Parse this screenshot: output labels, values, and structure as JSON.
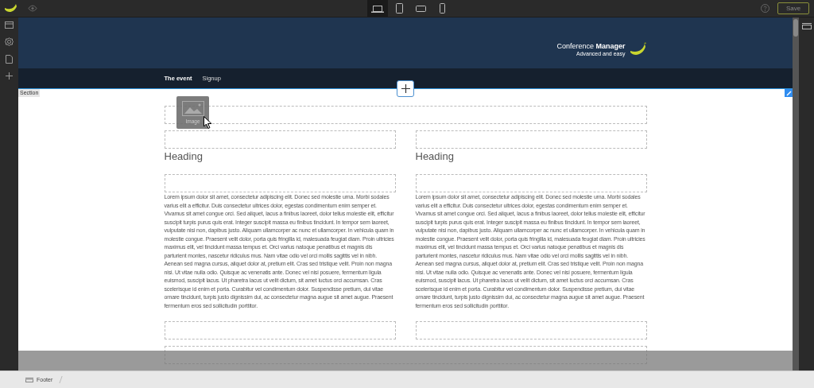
{
  "toolbar": {
    "devices": [
      {
        "kind": "laptop",
        "selected": true
      },
      {
        "kind": "tablet",
        "selected": false
      },
      {
        "kind": "tablet-landscape",
        "selected": false
      },
      {
        "kind": "phone",
        "selected": false
      }
    ],
    "save_button": "Save"
  },
  "site_header": {
    "brand_light": "Conference",
    "brand_bold": "Manager",
    "tagline": "Advanced and easy"
  },
  "nav": [
    {
      "label": "The event",
      "selected": true
    },
    {
      "label": "Signup",
      "selected": false
    }
  ],
  "section_label": "Section",
  "drag_item": {
    "label": "Image"
  },
  "columns": [
    {
      "heading": "Heading",
      "text": "Lorem ipsum dolor sit amet, consectetur adipiscing elit. Donec sed molestie urna. Morbi sodales varius elit a efficitur. Duis consectetur ultrices dolor, egestas condimentum enim semper et. Vivamus sit amet congue orci. Sed aliquet, lacus a finibus laoreet, dolor tellus molestie elit, efficitur suscipit turpis purus quis erat. Integer suscipit massa eu finibus tincidunt. In tempor sem laoreet, vulputate nisi non, dapibus justo. Aliquam ullamcorper ac nunc et ullamcorper. In vehicula quam in molestie congue. Praesent velit dolor, porta quis fringilla id, malesuada feugiat diam. Proin ultricies maximus elit, vel tincidunt massa tempus et. Orci varius natoque penatibus et magnis dis parturient montes, nascetur ridiculus mus. Nam vitae odio vel orci mollis sagittis vel in nibh. Aenean sed magna cursus, aliquet dolor at, pretium elit. Cras sed tristique velit. Proin non magna nisi. Ut vitae nulla odio. Quisque ac venenatis ante. Donec vel nisi posuere, fermentum ligula euismod, suscipit lacus. Ut pharetra lacus ut velit dictum, sit amet luctus orci accumsan. Cras scelerisque id enim et porta. Curabitur vel condimentum dolor. Suspendisse pretium, dui vitae ornare tincidunt, turpis justo dignissim dui, ac consectetur magna augue sit amet augue. Praesent fermentum eros sed sollicitudin porttitor."
    },
    {
      "heading": "Heading",
      "text": "Lorem ipsum dolor sit amet, consectetur adipiscing elit. Donec sed molestie urna. Morbi sodales varius elit a efficitur. Duis consectetur ultrices dolor, egestas condimentum enim semper et. Vivamus sit amet congue orci. Sed aliquet, lacus a finibus laoreet, dolor tellus molestie elit, efficitur suscipit turpis purus quis erat. Integer suscipit massa eu finibus tincidunt. In tempor sem laoreet, vulputate nisi non, dapibus justo. Aliquam ullamcorper ac nunc et ullamcorper. In vehicula quam in molestie congue. Praesent velit dolor, porta quis fringilla id, malesuada feugiat diam. Proin ultricies maximus elit, vel tincidunt massa tempus et. Orci varius natoque penatibus et magnis dis parturient montes, nascetur ridiculus mus. Nam vitae odio vel orci mollis sagittis vel in nibh. Aenean sed magna cursus, aliquet dolor at, pretium elit. Cras sed tristique velit. Proin non magna nisi. Ut vitae nulla odio. Quisque ac venenatis ante. Donec vel nisi posuere, fermentum ligula euismod, suscipit lacus. Ut pharetra lacus ut velit dictum, sit amet luctus orci accumsan. Cras scelerisque id enim et porta. Curabitur vel condimentum dolor. Suspendisse pretium, dui vitae ornare tincidunt, turpis justo dignissim dui, ac consectetur magna augue sit amet augue. Praesent fermentum eros sed sollicitudin porttitor."
    }
  ],
  "breadcrumb": "Footer"
}
